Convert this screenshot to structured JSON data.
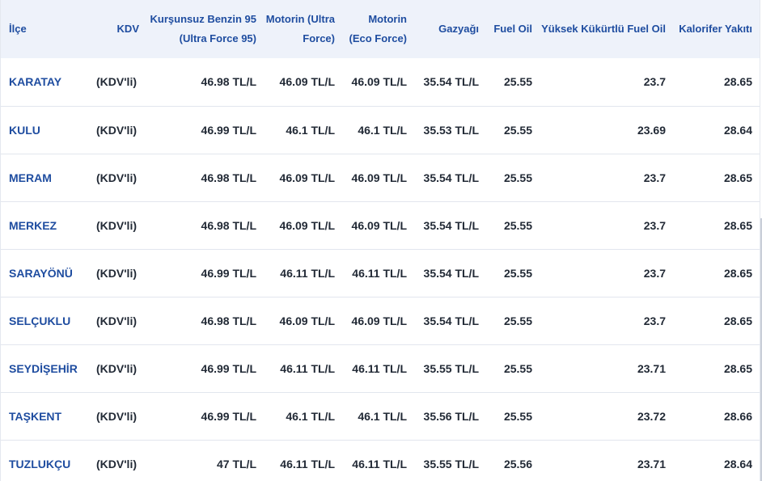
{
  "table": {
    "headers": {
      "ilce": "İlçe",
      "kdv": "KDV",
      "benzin": "Kurşunsuz Benzin 95 (Ultra Force 95)",
      "motorin_ultra": "Motorin (Ultra Force)",
      "motorin_eco": "Motorin (Eco Force)",
      "gazyagi": "Gazyağı",
      "fuel_oil": "Fuel Oil",
      "yuksek_kukurtlu": "Yüksek Kükürtlü Fuel Oil",
      "kalorifer": "Kalorifer Yakıtı"
    },
    "rows": [
      {
        "ilce": "KARATAY",
        "kdv": "(KDV'li)",
        "benzin": "46.98 TL/L",
        "motorin_ultra": "46.09 TL/L",
        "motorin_eco": "46.09 TL/L",
        "gazyagi": "35.54 TL/L",
        "fuel_oil": "25.55",
        "yuksek_kukurtlu": "23.7",
        "kalorifer": "28.65"
      },
      {
        "ilce": "KULU",
        "kdv": "(KDV'li)",
        "benzin": "46.99 TL/L",
        "motorin_ultra": "46.1 TL/L",
        "motorin_eco": "46.1 TL/L",
        "gazyagi": "35.53 TL/L",
        "fuel_oil": "25.55",
        "yuksek_kukurtlu": "23.69",
        "kalorifer": "28.64"
      },
      {
        "ilce": "MERAM",
        "kdv": "(KDV'li)",
        "benzin": "46.98 TL/L",
        "motorin_ultra": "46.09 TL/L",
        "motorin_eco": "46.09 TL/L",
        "gazyagi": "35.54 TL/L",
        "fuel_oil": "25.55",
        "yuksek_kukurtlu": "23.7",
        "kalorifer": "28.65"
      },
      {
        "ilce": "MERKEZ",
        "kdv": "(KDV'li)",
        "benzin": "46.98 TL/L",
        "motorin_ultra": "46.09 TL/L",
        "motorin_eco": "46.09 TL/L",
        "gazyagi": "35.54 TL/L",
        "fuel_oil": "25.55",
        "yuksek_kukurtlu": "23.7",
        "kalorifer": "28.65"
      },
      {
        "ilce": "SARAYÖNÜ",
        "kdv": "(KDV'li)",
        "benzin": "46.99 TL/L",
        "motorin_ultra": "46.11 TL/L",
        "motorin_eco": "46.11 TL/L",
        "gazyagi": "35.54 TL/L",
        "fuel_oil": "25.55",
        "yuksek_kukurtlu": "23.7",
        "kalorifer": "28.65"
      },
      {
        "ilce": "SELÇUKLU",
        "kdv": "(KDV'li)",
        "benzin": "46.98 TL/L",
        "motorin_ultra": "46.09 TL/L",
        "motorin_eco": "46.09 TL/L",
        "gazyagi": "35.54 TL/L",
        "fuel_oil": "25.55",
        "yuksek_kukurtlu": "23.7",
        "kalorifer": "28.65"
      },
      {
        "ilce": "SEYDİŞEHİR",
        "kdv": "(KDV'li)",
        "benzin": "46.99 TL/L",
        "motorin_ultra": "46.11 TL/L",
        "motorin_eco": "46.11 TL/L",
        "gazyagi": "35.55 TL/L",
        "fuel_oil": "25.55",
        "yuksek_kukurtlu": "23.71",
        "kalorifer": "28.65"
      },
      {
        "ilce": "TAŞKENT",
        "kdv": "(KDV'li)",
        "benzin": "46.99 TL/L",
        "motorin_ultra": "46.1 TL/L",
        "motorin_eco": "46.1 TL/L",
        "gazyagi": "35.56 TL/L",
        "fuel_oil": "25.55",
        "yuksek_kukurtlu": "23.72",
        "kalorifer": "28.66"
      },
      {
        "ilce": "TUZLUKÇU",
        "kdv": "(KDV'li)",
        "benzin": "47 TL/L",
        "motorin_ultra": "46.11 TL/L",
        "motorin_eco": "46.11 TL/L",
        "gazyagi": "35.55 TL/L",
        "fuel_oil": "25.56",
        "yuksek_kukurtlu": "23.71",
        "kalorifer": "28.64"
      }
    ]
  },
  "colors": {
    "header_background": "#eef2fa",
    "header_text": "#1f4da0",
    "district_link": "#1f4da0",
    "cell_text": "#222a36",
    "row_divider": "#e2e6ee"
  }
}
